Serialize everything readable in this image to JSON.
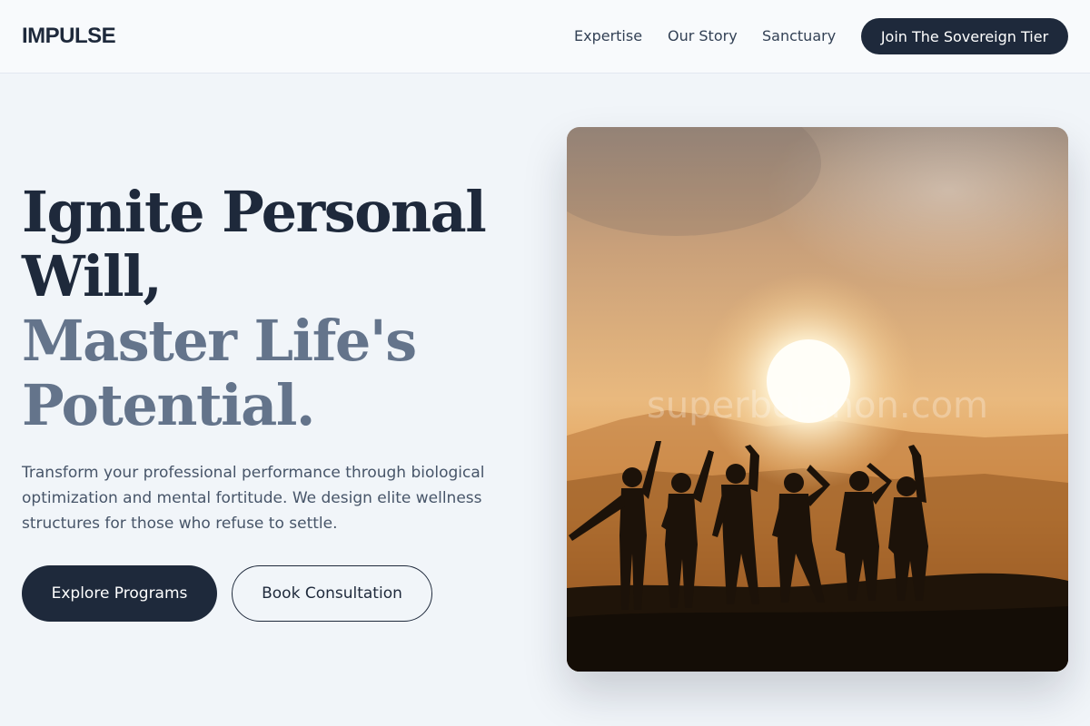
{
  "header": {
    "logo": "IMPULSE",
    "nav": [
      {
        "label": "Expertise"
      },
      {
        "label": "Our Story"
      },
      {
        "label": "Sanctuary"
      }
    ],
    "cta_label": "Join The Sovereign Tier"
  },
  "hero": {
    "headline_line1": "Ignite Personal",
    "headline_line2": "Will,",
    "headline_line3": "Master Life's",
    "headline_line4": "Potential.",
    "description": "Transform your professional performance through biological optimization and mental fortitude. We design elite wellness structures for those who refuse to settle.",
    "primary_button": "Explore Programs",
    "secondary_button": "Book Consultation",
    "image": {
      "subject": "silhouettes of six people waving at sunset on a hilltop"
    }
  },
  "colors": {
    "page_bg": "#f1f5f9",
    "header_bg": "#f8fafc",
    "primary": "#1e293b",
    "muted_heading": "#64748b",
    "body_text": "#475569"
  }
}
